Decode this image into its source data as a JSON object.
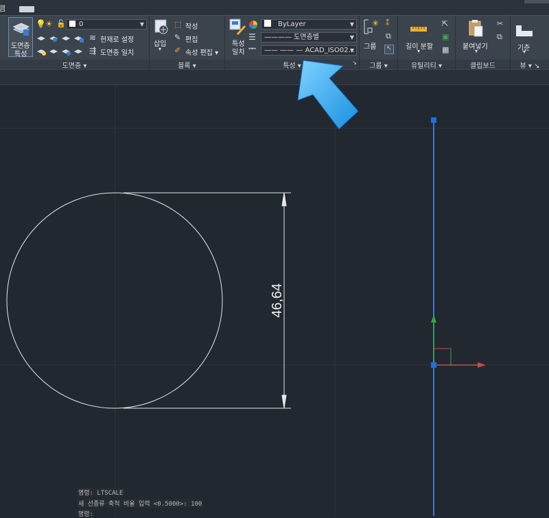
{
  "topbar": {
    "cut_text": "램"
  },
  "ribbon": {
    "layer": {
      "big_button_label_1": "도면층",
      "big_button_label_2": "특성",
      "current_layer": "0",
      "make_current": "현재로 설정",
      "match_layer": "도면층 일치",
      "title": "도면층"
    },
    "block": {
      "insert": "삽입",
      "create": "작성",
      "edit": "편집",
      "edit_attributes": "속성 편집",
      "title": "블록"
    },
    "properties": {
      "match_label_1": "특성",
      "match_label_2": "일치",
      "color_combo": "ByLayer",
      "lineweight_combo": "———— 도면층별",
      "linetype_combo": "—— —— — ACAD_ISO02...",
      "title": "특성"
    },
    "groups": {
      "group": "그룹",
      "title": "그룹"
    },
    "utilities": {
      "measure": "길이 분할",
      "title": "유틸리티"
    },
    "clipboard": {
      "paste": "붙여넣기",
      "title": "클립보드"
    },
    "view": {
      "base": "기준",
      "title": "뷰"
    }
  },
  "drawing": {
    "dimension_text": "46,64",
    "colors": {
      "background": "#212830",
      "grid": "#2c343e",
      "blue_line": "#3b7ad8",
      "grip": "#1e6fe0",
      "ucs_x": "#c0504d",
      "ucs_y": "#3ea33e"
    }
  },
  "command_line": {
    "line1": "명령: LTSCALE",
    "line2": "새 선종류 축척 비율 입력 <0.5000>: 100",
    "line3": "명령:"
  }
}
